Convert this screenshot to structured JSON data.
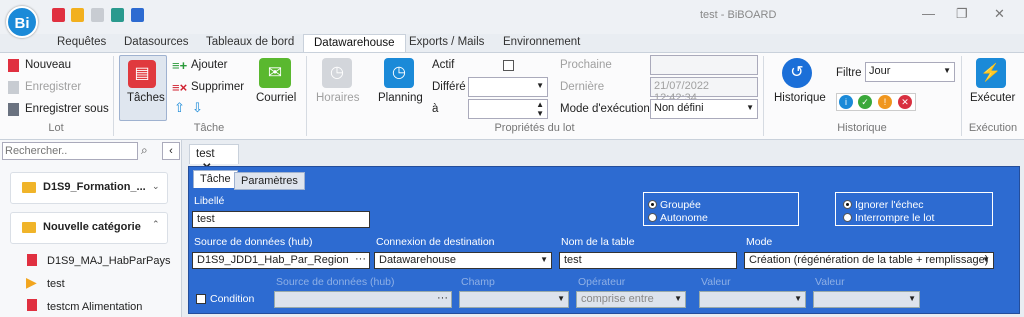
{
  "window": {
    "title": "test - BiBOARD",
    "logo": "Bi"
  },
  "tabs": [
    "Requêtes",
    "Datasources",
    "Tableaux de bord",
    "Datawarehouse",
    "Exports / Mails",
    "Environnement"
  ],
  "lot": {
    "nouveau": "Nouveau",
    "enregistrer": "Enregistrer",
    "enregistrer_sous": "Enregistrer sous",
    "group": "Lot"
  },
  "tache": {
    "taches": "Tâches",
    "ajouter": "Ajouter",
    "supprimer": "Supprimer",
    "courriel": "Courriel",
    "group": "Tâche"
  },
  "props": {
    "horaires": "Horaires",
    "planning": "Planning",
    "actif": "Actif",
    "differe": "Différé",
    "a": "à",
    "prochaine": "Prochaine",
    "derniere": "Dernière",
    "derniere_val": "21/07/2022 12:42:34",
    "mode_exec": "Mode d'exécution",
    "mode_exec_val": "Non défini",
    "group": "Propriétés du lot"
  },
  "historique": {
    "historique": "Historique",
    "filtre": "Filtre",
    "filtre_val": "Jour",
    "group": "Historique"
  },
  "execution": {
    "executer": "Exécuter",
    "group": "Exécution"
  },
  "left": {
    "search_placeholder": "Rechercher..",
    "cat1": "D1S9_Formation_...",
    "cat2": "Nouvelle catégorie",
    "items": [
      "D1S9_MAJ_HabParPays",
      "test",
      "testcm Alimentation"
    ]
  },
  "doc_tab": "test",
  "subtabs": [
    "Tâche",
    "Paramètres"
  ],
  "form": {
    "libelle_label": "Libellé",
    "libelle_val": "test",
    "groupee": "Groupée",
    "autonome": "Autonome",
    "ignorer": "Ignorer l'échec",
    "interrompre": "Interrompre le lot",
    "source_label": "Source de données (hub)",
    "source_val": "D1S9_JDD1_Hab_Par_Region",
    "connexion_label": "Connexion de destination",
    "connexion_val": "Datawarehouse",
    "table_label": "Nom de la table",
    "table_val": "test",
    "mode_label": "Mode",
    "mode_val": "Création (régénération de la table + remplissage)",
    "condition": "Condition",
    "cond_source": "Source de données (hub)",
    "champ": "Champ",
    "operateur": "Opérateur",
    "operateur_val": "comprise entre",
    "valeur1": "Valeur",
    "valeur2": "Valeur"
  },
  "colors": {
    "accent": "#2d6bd1",
    "brand": "#1b8ad8"
  }
}
